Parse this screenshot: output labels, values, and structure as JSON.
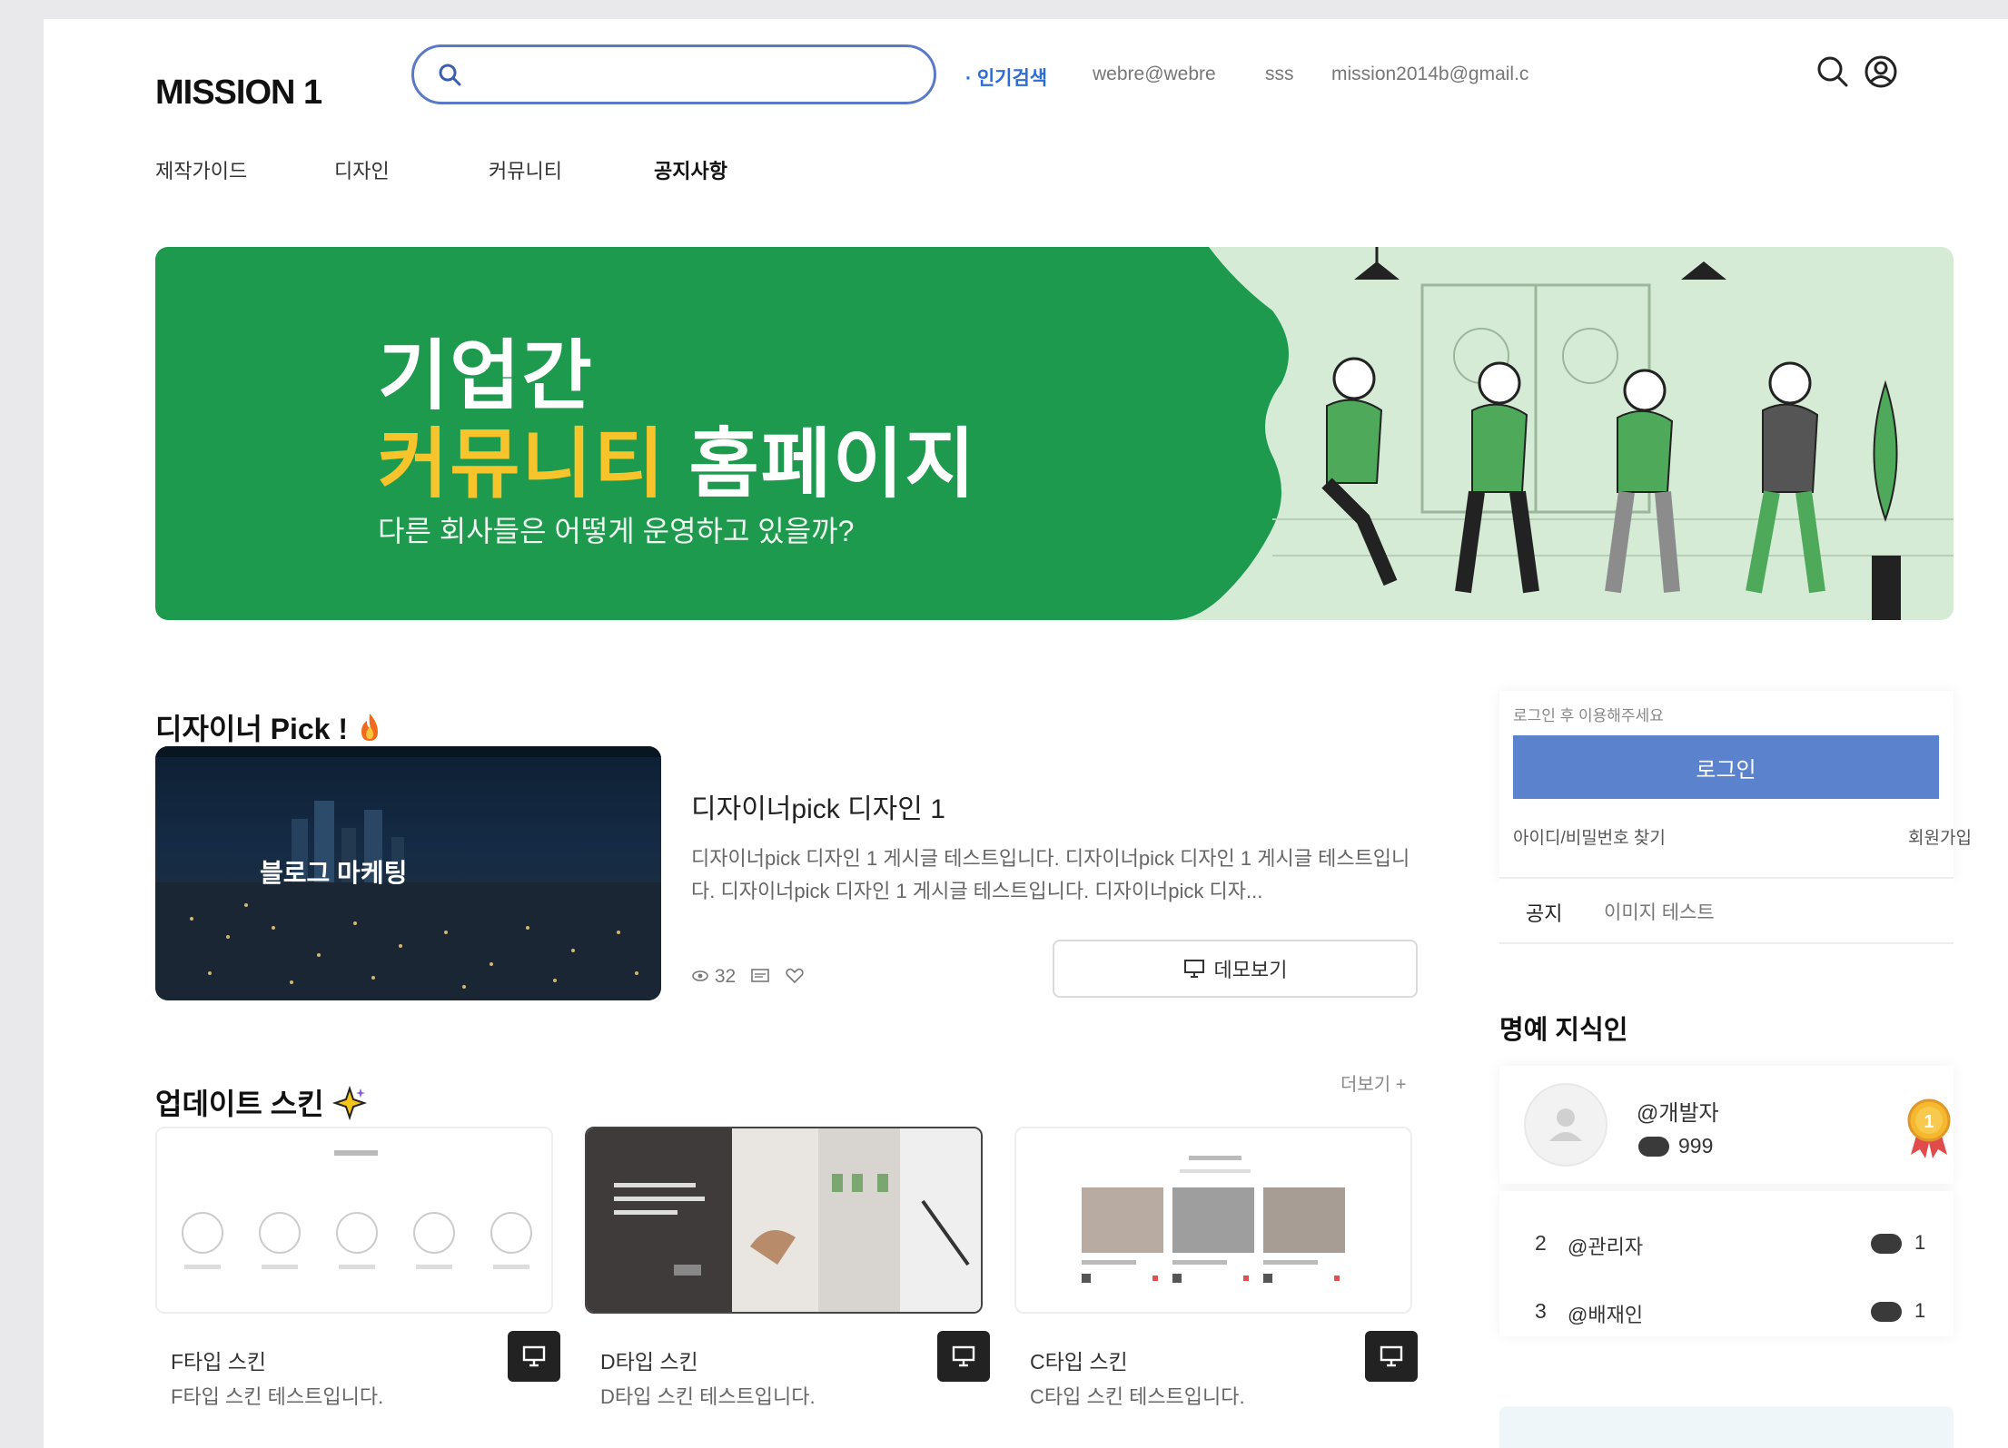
{
  "header": {
    "logo": "MISSION 1",
    "search_placeholder": "",
    "popular_label": "· 인기검색",
    "popular_terms": [
      "webre@webre",
      "sss",
      "mission2014b@gmail.c"
    ]
  },
  "nav": {
    "items": [
      {
        "label": "제작가이드"
      },
      {
        "label": "디자인"
      },
      {
        "label": "커뮤니티"
      },
      {
        "label": "공지사항"
      }
    ]
  },
  "banner": {
    "line1": "기업간",
    "line2_highlight": "커뮤니티",
    "line2_rest": " 홈페이지",
    "subtitle": "다른 회사들은 어떻게 운영하고 있을까?",
    "colors": {
      "green": "#1d9a4e",
      "light": "#d6ebd6",
      "highlight": "#f7c42c"
    }
  },
  "designer_pick": {
    "title": "디자이너 Pick !",
    "title_icon": "fire-icon",
    "image_overlay": "블로그 마케팅",
    "post_title": "디자이너pick 디자인 1",
    "post_desc": "디자이너pick 디자인 1 게시글 테스트입니다. 디자이너pick 디자인 1 게시글 테스트입니다. 디자이너pick 디자인 1 게시글 테스트입니다. 디자이너pick 디자...",
    "views": "32",
    "demo_label": "데모보기"
  },
  "update_skin": {
    "title": "업데이트 스킨",
    "title_icon": "sparkle-icon",
    "more_label": "더보기 +",
    "items": [
      {
        "name": "F타입 스킨",
        "desc": "F타입 스킨 테스트입니다."
      },
      {
        "name": "D타입 스킨",
        "desc": "D타입 스킨 테스트입니다."
      },
      {
        "name": "C타입 스킨",
        "desc": "C타입 스킨 테스트입니다."
      }
    ]
  },
  "sidebar": {
    "login_hint": "로그인 후 이용해주세요",
    "login_button": "로그인",
    "find_label": "아이디/비밀번호 찾기",
    "join_label": "회원가입",
    "notice_label": "공지",
    "notice_title": "이미지 테스트",
    "hall_of_fame_title": "명예 지식인",
    "first": {
      "name": "@개발자",
      "points": "999"
    },
    "ranks": [
      {
        "rank": "2",
        "name": "@관리자",
        "points": "1"
      },
      {
        "rank": "3",
        "name": "@배재인",
        "points": "1"
      }
    ],
    "accent": "#5b82cc"
  }
}
